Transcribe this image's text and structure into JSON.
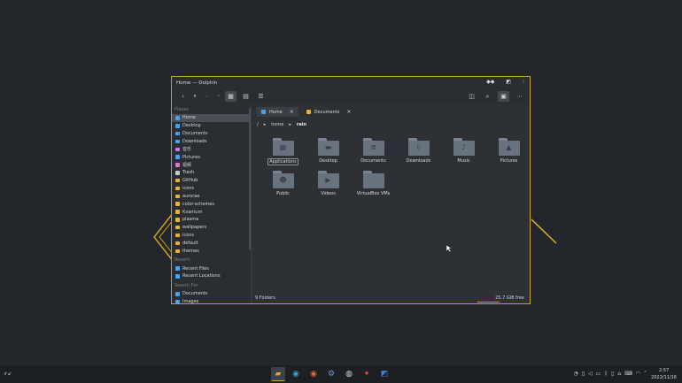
{
  "window": {
    "title": "Home — Dolphin"
  },
  "titlebar_buttons": [
    "minimize-icon",
    "maximize-icon",
    "close-icon"
  ],
  "places": {
    "heading": "Places",
    "items": [
      {
        "label": "Home",
        "icon": "home-icon",
        "color": "#4aa3e6"
      },
      {
        "label": "Desktop",
        "icon": "desktop-icon",
        "color": "#4aa3e6"
      },
      {
        "label": "Documents",
        "icon": "documents-icon",
        "color": "#4aa3e6"
      },
      {
        "label": "Downloads",
        "icon": "downloads-icon",
        "color": "#4aa3e6"
      },
      {
        "label": "音乐",
        "icon": "music-icon",
        "color": "#c77fd8"
      },
      {
        "label": "Pictures",
        "icon": "pictures-icon",
        "color": "#4aa3e6"
      },
      {
        "label": "视频",
        "icon": "videos-icon",
        "color": "#d97bc8"
      },
      {
        "label": "Trash",
        "icon": "trash-icon",
        "color": "#c6cbd0"
      },
      {
        "label": "GitHub",
        "icon": "folder-icon",
        "color": "#e0b63c"
      },
      {
        "label": "icons",
        "icon": "folder-icon",
        "color": "#e0b63c"
      },
      {
        "label": "aurorae",
        "icon": "folder-icon",
        "color": "#e0b63c"
      },
      {
        "label": "color-schemes",
        "icon": "folder-icon",
        "color": "#e0b63c"
      },
      {
        "label": "Kvantum",
        "icon": "folder-icon",
        "color": "#e0b63c"
      },
      {
        "label": "plasma",
        "icon": "folder-icon",
        "color": "#e0b63c"
      },
      {
        "label": "wallpapers",
        "icon": "folder-icon",
        "color": "#e0b63c"
      },
      {
        "label": "icons",
        "icon": "folder-icon",
        "color": "#e0b63c"
      },
      {
        "label": "default",
        "icon": "folder-icon",
        "color": "#e0b63c"
      },
      {
        "label": "themes",
        "icon": "folder-icon",
        "color": "#e0b63c"
      }
    ]
  },
  "recent": {
    "heading": "Recent",
    "items": [
      {
        "label": "Recent Files",
        "icon": "recent-files-icon",
        "color": "#4aa3e6"
      },
      {
        "label": "Recent Locations",
        "icon": "recent-locations-icon",
        "color": "#4aa3e6"
      }
    ]
  },
  "search_for": {
    "heading": "Search For",
    "items": [
      {
        "label": "Documents",
        "icon": "documents-icon",
        "color": "#4aa3e6"
      },
      {
        "label": "Images",
        "icon": "images-icon",
        "color": "#4aa3e6"
      }
    ]
  },
  "tabs": [
    {
      "label": "Home",
      "icon": "home-icon",
      "active": true
    },
    {
      "label": "Documents",
      "icon": "folder-icon",
      "active": false
    }
  ],
  "breadcrumb": {
    "root": "/",
    "parent": "home",
    "current": "rain"
  },
  "files": [
    {
      "label": "Applications",
      "icon": "applications-folder-icon",
      "emblem": "▦"
    },
    {
      "label": "Desktop",
      "icon": "desktop-folder-icon",
      "emblem": "▬"
    },
    {
      "label": "Documents",
      "icon": "documents-folder-icon",
      "emblem": "≣"
    },
    {
      "label": "Downloads",
      "icon": "downloads-folder-icon",
      "emblem": "⇩"
    },
    {
      "label": "Music",
      "icon": "music-folder-icon",
      "emblem": "♪"
    },
    {
      "label": "Pictures",
      "icon": "pictures-folder-icon",
      "emblem": "▲"
    },
    {
      "label": "Public",
      "icon": "public-folder-icon",
      "emblem": "☻"
    },
    {
      "label": "Videos",
      "icon": "videos-folder-icon",
      "emblem": "▶"
    },
    {
      "label": "VirtualBox VMs",
      "icon": "folder-icon",
      "emblem": ""
    }
  ],
  "status": {
    "count": "9 Folders",
    "free": "25.7 GiB free"
  },
  "taskbar": {
    "apps": [
      "dolphin-icon",
      "edge-icon",
      "firefox-icon",
      "settings-icon",
      "github-icon",
      "figma-icon",
      "store-icon"
    ],
    "clock_time": "2:57",
    "clock_date": "2022/11/16"
  },
  "colors": {
    "accent": "#c9a227",
    "window_bg": "#2b2f33",
    "desktop_bg": "#23262a"
  }
}
